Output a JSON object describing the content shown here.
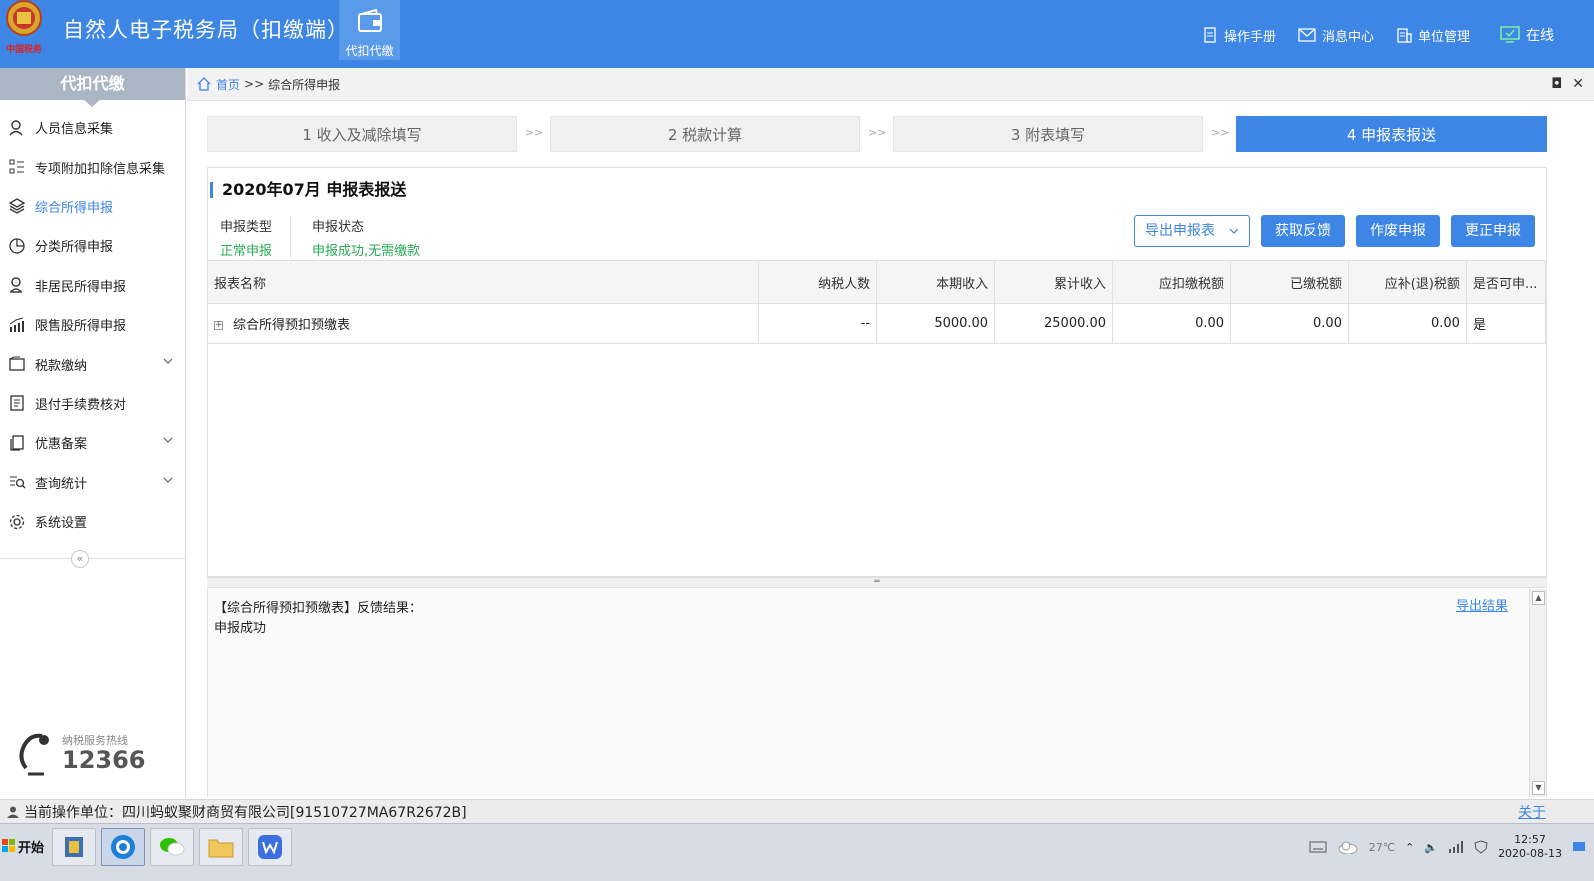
{
  "header": {
    "title": "自然人电子税务局（扣缴端）",
    "logo_text": "中国税务",
    "tab_label": "代扣代缴",
    "links": [
      {
        "label": "操作手册",
        "icon": "document-icon"
      },
      {
        "label": "消息中心",
        "icon": "mail-icon"
      },
      {
        "label": "单位管理",
        "icon": "building-icon"
      }
    ],
    "online_label": "在线"
  },
  "sidebar": {
    "title": "代扣代缴",
    "items": [
      {
        "label": "人员信息采集",
        "icon": "user-icon"
      },
      {
        "label": "专项附加扣除信息采集",
        "icon": "list-icon"
      },
      {
        "label": "综合所得申报",
        "icon": "layers-icon",
        "active": true
      },
      {
        "label": "分类所得申报",
        "icon": "pie-icon"
      },
      {
        "label": "非居民所得申报",
        "icon": "person-icon"
      },
      {
        "label": "限售股所得申报",
        "icon": "chart-icon"
      },
      {
        "label": "税款缴纳",
        "icon": "wallet-icon",
        "expandable": true
      },
      {
        "label": "退付手续费核对",
        "icon": "receipt-icon"
      },
      {
        "label": "优惠备案",
        "icon": "copy-icon",
        "expandable": true
      },
      {
        "label": "查询统计",
        "icon": "search-list-icon",
        "expandable": true
      },
      {
        "label": "系统设置",
        "icon": "gear-icon"
      }
    ],
    "collapse_glyph": "«",
    "hotline_label": "纳税服务热线",
    "hotline_number": "12366"
  },
  "breadcrumb": {
    "home": "首页",
    "separator": ">>",
    "current": "综合所得申报"
  },
  "steps": [
    {
      "label": "1 收入及减除填写"
    },
    {
      "label": "2 税款计算"
    },
    {
      "label": "3 附表填写"
    },
    {
      "label": "4 申报表报送",
      "active": true
    }
  ],
  "step_arrow": ">>",
  "panel": {
    "title": "2020年07月  申报表报送",
    "type_label": "申报类型",
    "type_value": "正常申报",
    "status_label": "申报状态",
    "status_value": "申报成功,无需缴款",
    "buttons": {
      "export": "导出申报表",
      "feedback": "获取反馈",
      "void": "作废申报",
      "correct": "更正申报"
    }
  },
  "table": {
    "headers": [
      "报表名称",
      "纳税人数",
      "本期收入",
      "累计收入",
      "应扣缴税额",
      "已缴税额",
      "应补(退)税额",
      "是否可申..."
    ],
    "rows": [
      {
        "expand": "+",
        "name": "综合所得预扣预缴表",
        "count": "--",
        "income": "5000.00",
        "cumulative": "25000.00",
        "withhold": "0.00",
        "paid": "0.00",
        "refund": "0.00",
        "declarable": "是"
      }
    ]
  },
  "feedback": {
    "heading": "【综合所得预扣预缴表】反馈结果：",
    "text": "申报成功",
    "export_link": "导出结果"
  },
  "statusbar": {
    "text": "当前操作单位：四川蚂蚁聚财商贸有限公司[91510727MA67R2672B]",
    "about": "关于"
  },
  "taskbar": {
    "start_label": "开始",
    "weather": "27℃",
    "time": "12:57",
    "date": "2020-08-13"
  },
  "colors": {
    "brand_blue": "#3d86e5",
    "success_green": "#2bab54",
    "sidebar_title_bg": "#aab6c3"
  }
}
